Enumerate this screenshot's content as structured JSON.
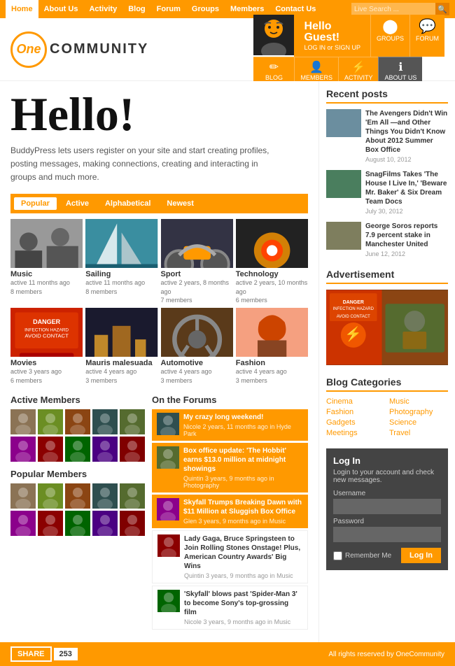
{
  "nav": {
    "items": [
      "Home",
      "About Us",
      "Activity",
      "Blog",
      "Forum",
      "Groups",
      "Members",
      "Contact Us"
    ],
    "active": "Home",
    "search_placeholder": "Live Search ..."
  },
  "logo": {
    "one": "One",
    "community": "Community"
  },
  "hero": {
    "greeting": "Hello",
    "guest": "Guest!",
    "login_label": "LOG IN or SIGN UP",
    "icons": [
      {
        "label": "GROUPS",
        "sym": "⬤"
      },
      {
        "label": "FORUM",
        "sym": "💬"
      },
      {
        "label": "BLOG",
        "sym": "✏"
      },
      {
        "label": "MEMBERS",
        "sym": "👤"
      },
      {
        "label": "ACTIVITY",
        "sym": "⚡"
      },
      {
        "label": "ABOUT US",
        "sym": "ℹ"
      }
    ]
  },
  "hello": {
    "title": "Hello!",
    "description": "BuddyPress lets users register on your site and start creating profiles, posting messages, making connections, creating and interacting in groups and much more."
  },
  "group_tabs": [
    "Popular",
    "Active",
    "Alphabetical",
    "Newest"
  ],
  "groups": [
    {
      "name": "Music",
      "meta": "active 11 months ago",
      "members": "8 members"
    },
    {
      "name": "Sailing",
      "meta": "active 11 months ago",
      "members": "8 members"
    },
    {
      "name": "Sport",
      "meta": "active 2 years, 8 months ago",
      "members": "7 members"
    },
    {
      "name": "Technology",
      "meta": "active 2 years, 10 months ago",
      "members": "6 members"
    },
    {
      "name": "Movies",
      "meta": "active 3 years ago",
      "members": "6 members"
    },
    {
      "name": "Mauris malesuada",
      "meta": "active 4 years ago",
      "members": "3 members"
    },
    {
      "name": "Automotive",
      "meta": "active 4 years ago",
      "members": "3 members"
    },
    {
      "name": "Fashion",
      "meta": "active 4 years ago",
      "members": "3 members"
    }
  ],
  "group_colors": [
    "#8B9E6E",
    "#4A9E9E",
    "#E87830",
    "#CC4422",
    "#CC3322",
    "#C0882A",
    "#884422",
    "#CC6644"
  ],
  "active_members_title": "Active Members",
  "popular_members_title": "Popular Members",
  "on_forums_title": "On the Forums",
  "forum_posts": [
    {
      "title": "My crazy long weekend!",
      "meta": "Nicole 2 years, 11 months ago in Hyde Park",
      "highlight": true
    },
    {
      "title": "Box office update: 'The Hobbit' earns $13.0 million at midnight showings",
      "meta": "Quintin 3 years, 9 months ago in Photography",
      "highlight": true
    },
    {
      "title": "Skyfall Trumps Breaking Dawn with $11 Million at Sluggish Box Office",
      "meta": "Glen 3 years, 9 months ago in Music",
      "highlight": true
    },
    {
      "title": "Lady Gaga, Bruce Springsteen to Join Rolling Stones Onstage! Plus, American Country Awards' Big Wins",
      "meta": "Quintin 3 years, 9 months ago in Music",
      "highlight": false
    },
    {
      "title": "'Skyfall' blows past 'Spider-Man 3' to become Sony's top-grossing film",
      "meta": "Nicole 3 years, 9 months ago in Music",
      "highlight": false
    }
  ],
  "sidebar": {
    "recent_posts_title": "Recent posts",
    "posts": [
      {
        "title": "The Avengers Didn't Win 'Em All —and Other Things You Didn't Know About 2012 Summer Box Office",
        "date": "August 10, 2012"
      },
      {
        "title": "SnagFilms Takes 'The House I Live In,' 'Beware Mr. Baker' & Six Dream Team Docs",
        "date": "July 30, 2012"
      },
      {
        "title": "George Soros reports 7.9 percent stake in Manchester United",
        "date": "June 12, 2012"
      }
    ],
    "ad_title": "Advertisement",
    "blog_cats_title": "Blog Categories",
    "blog_cats": [
      "Cinema",
      "Music",
      "Fashion",
      "Photography",
      "Gadgets",
      "Science",
      "Meetings",
      "Travel"
    ],
    "login": {
      "title": "Log In",
      "desc": "Login to your account and check new messages.",
      "username_label": "Username",
      "password_label": "Password",
      "remember_label": "Remember Me",
      "btn_label": "Log In"
    }
  },
  "footer": {
    "share_label": "Share",
    "share_count": "253",
    "copyright": "All rights reserved by OneCommunity"
  }
}
